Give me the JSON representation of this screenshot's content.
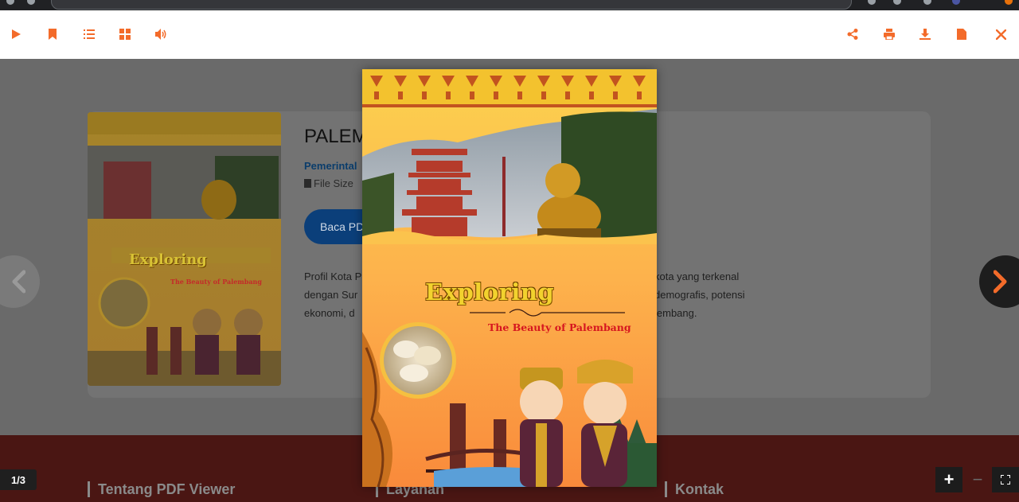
{
  "toolbar": {
    "left_icons": [
      "play-icon",
      "bookmark-icon",
      "list-icon",
      "grid-icon",
      "volume-icon"
    ],
    "right_icons": [
      "share-icon",
      "print-icon",
      "download-icon",
      "file-icon",
      "close-icon"
    ],
    "accent_color": "#f36b2a"
  },
  "card": {
    "title": "PALEM",
    "org": "Pemerintal",
    "file_size_label": "File Size",
    "read_button": "Baca PD",
    "desc_left": [
      "Profil Kota P",
      "dengan Sur",
      "ekonomi, d"
    ],
    "desc_right": [
      "kota yang terkenal",
      "demografis, potensi",
      "lembang."
    ]
  },
  "cover": {
    "title": "Exploring",
    "subtitle": "The Beauty of Palembang"
  },
  "viewer": {
    "page_counter": "1/3",
    "zoom_in": "+",
    "zoom_out": "−"
  },
  "footer": {
    "columns": [
      "Tentang PDF Viewer",
      "Layanan",
      "Kontak"
    ],
    "color": "#4a1613"
  }
}
